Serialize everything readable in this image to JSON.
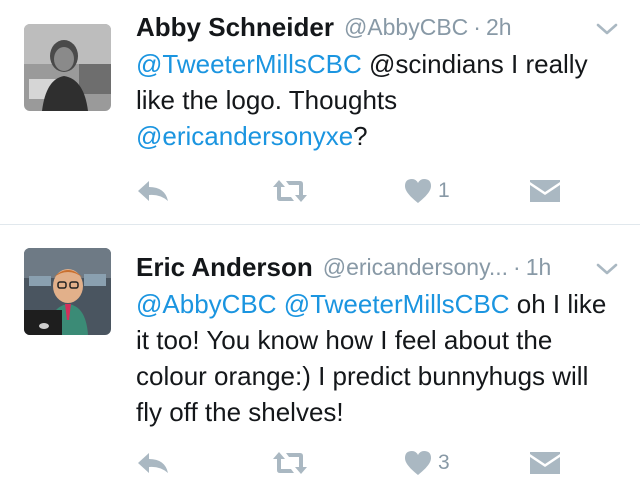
{
  "tweets": [
    {
      "name": "Abby Schneider",
      "handle": "@AbbyCBC",
      "separator": "·",
      "time": "2h",
      "text": {
        "m1": "@TweeterMillsCBC",
        "t1": " @scindians I really like the logo. Thoughts ",
        "m2": "@ericandersonyxe",
        "t2": "?"
      },
      "actions": {
        "reply_icon": "reply-icon",
        "retweet_icon": "retweet-icon",
        "like_icon": "heart-icon",
        "like_count": "1",
        "dm_icon": "envelope-icon"
      }
    },
    {
      "name": "Eric Anderson",
      "handle": "@ericandersony...",
      "separator": "·",
      "time": "1h",
      "text": {
        "m1": "@AbbyCBC",
        "sp": " ",
        "m2": "@TweeterMillsCBC",
        "t1": " oh I like it too! You know how I feel about the colour orange:) I predict bunnyhugs will fly off the shelves!"
      },
      "actions": {
        "reply_icon": "reply-icon",
        "retweet_icon": "retweet-icon",
        "like_icon": "heart-icon",
        "like_count": "3",
        "dm_icon": "envelope-icon"
      }
    }
  ],
  "colors": {
    "text": "#14171a",
    "muted": "#8899a6",
    "link": "#1b95e0",
    "icon": "#aab8c2",
    "divider": "#e1e8ed"
  }
}
